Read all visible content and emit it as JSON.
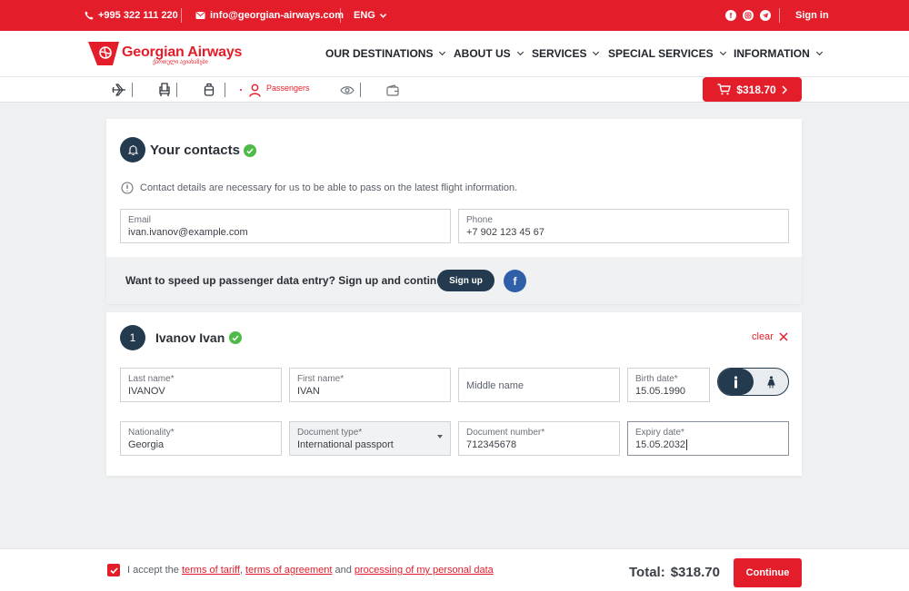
{
  "topbar": {
    "phone": "+995 322 111 220",
    "email": "info@georgian-airways.com",
    "language": "ENG",
    "sign_in": "Sign in"
  },
  "header": {
    "logo_text": "Georgian Airways",
    "logo_sub": "ქართული ავიახაზები",
    "nav": [
      "OUR DESTINATIONS",
      "ABOUT US",
      "SERVICES",
      "SPECIAL SERVICES",
      "INFORMATION"
    ]
  },
  "steps": {
    "active_label": "Passengers",
    "cart_total": "$318.70"
  },
  "contacts": {
    "title": "Your contacts",
    "info": "Contact details are necessary for us to be able to pass on the latest flight information.",
    "email_label": "Email",
    "email_value": "ivan.ivanov@example.com",
    "phone_label": "Phone",
    "phone_value": "+7 902 123 45 67"
  },
  "banner": {
    "text": "Want to speed up passenger data entry? Sign up and continue.",
    "signup": "Sign up",
    "fb": "f"
  },
  "passenger": {
    "number": "1",
    "name": "Ivanov Ivan",
    "clear": "clear",
    "last_name_label": "Last name*",
    "last_name": "IVANOV",
    "first_name_label": "First name*",
    "first_name": "IVAN",
    "middle_name_placeholder": "Middle name",
    "birth_label": "Birth date*",
    "birth_date": "15.05.1990",
    "nationality_label": "Nationality*",
    "nationality": "Georgia",
    "doc_type_label": "Document type*",
    "doc_type": "International passport",
    "doc_number_label": "Document number*",
    "doc_number": "712345678",
    "expiry_label": "Expiry date*",
    "expiry_date": "15.05.2032"
  },
  "footer": {
    "accept_prefix": "I accept the",
    "terms_tariff": "terms of tariff",
    "comma": ",",
    "terms_agreement": "terms of agreement",
    "and": "and",
    "processing": "processing of my personal data",
    "total_label": "Total:",
    "total_value": "$318.70",
    "continue": "Continue",
    "checkbox_checked": true
  },
  "colors": {
    "brand_red": "#e31d2a",
    "navy": "#243a4f",
    "success_green": "#4cbb47",
    "facebook_blue": "#2f5fa8"
  }
}
